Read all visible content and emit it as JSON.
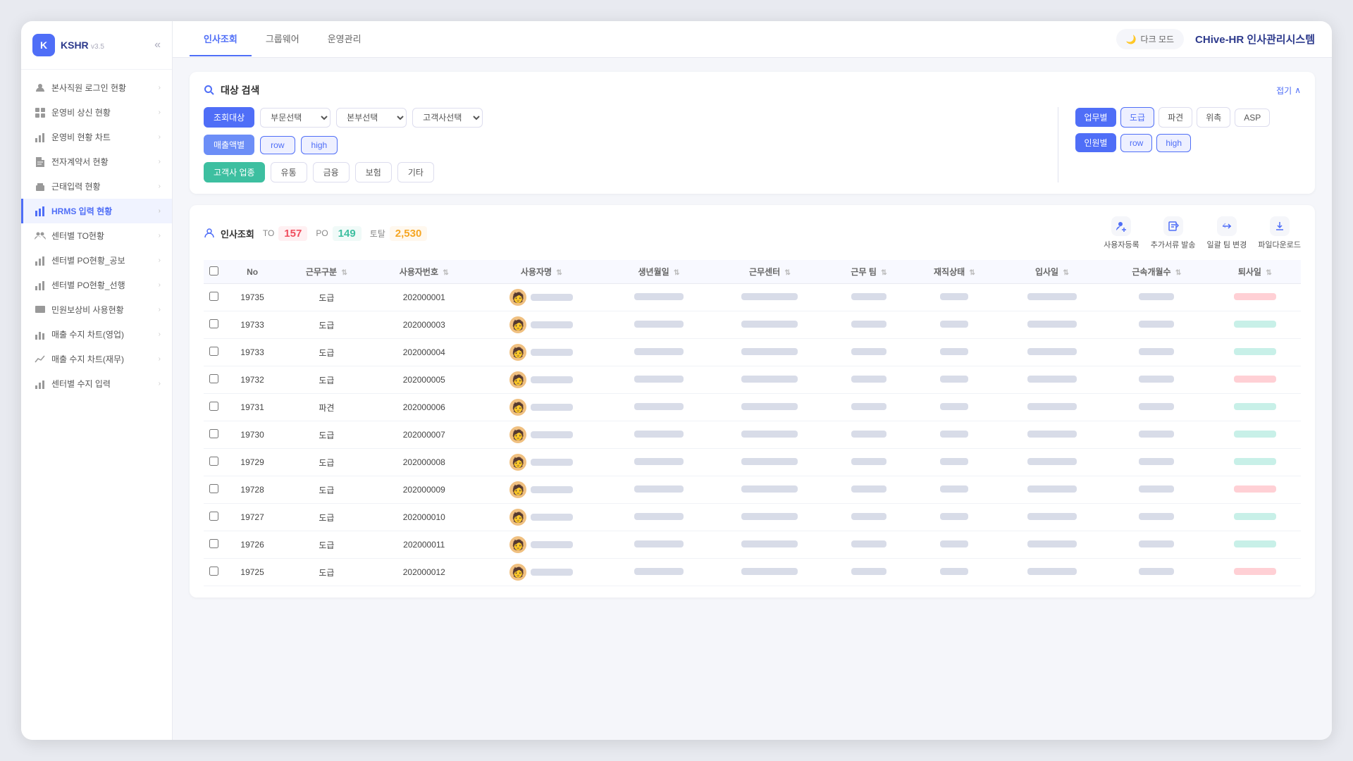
{
  "app": {
    "logo_text": "KSHR",
    "logo_version": "v3.5",
    "title": "CHive-HR 인사관리시스템",
    "dark_mode_label": "다크 모드"
  },
  "header_tabs": [
    {
      "label": "인사조회",
      "active": true
    },
    {
      "label": "그룹웨어",
      "active": false
    },
    {
      "label": "운영관리",
      "active": false
    }
  ],
  "sidebar": {
    "items": [
      {
        "label": "본사직원 로그인 현황",
        "icon": "person",
        "active": false
      },
      {
        "label": "운영비 상신 현황",
        "icon": "grid",
        "active": false
      },
      {
        "label": "운영비 현황 차트",
        "icon": "bar-chart",
        "active": false
      },
      {
        "label": "전자계약서 현황",
        "icon": "document",
        "active": false
      },
      {
        "label": "근태입력 현황",
        "icon": "print",
        "active": false
      },
      {
        "label": "HRMS 입력 현황",
        "icon": "bar-chart-2",
        "active": true
      },
      {
        "label": "센터별 TO현황",
        "icon": "person-group",
        "active": false
      },
      {
        "label": "센터별 PO현황_공보",
        "icon": "chart-bar",
        "active": false
      },
      {
        "label": "센터별 PO현황_선행",
        "icon": "chart-bar2",
        "active": false
      },
      {
        "label": "민원보상비 사용현황",
        "icon": "monitor",
        "active": false
      },
      {
        "label": "매출 수지 차트(영업)",
        "icon": "bar3",
        "active": false
      },
      {
        "label": "매출 수지 차트(재무)",
        "icon": "line-chart",
        "active": false
      },
      {
        "label": "센터별 수지 입력",
        "icon": "bar4",
        "active": false
      }
    ]
  },
  "search": {
    "title": "대상 검색",
    "fold_label": "접기",
    "rows": {
      "row1": {
        "label": "조회대상",
        "selects": [
          "부문선택",
          "본부선택",
          "고객사선택"
        ]
      },
      "row2": {
        "label": "매출액별",
        "tags": [
          "row",
          "high"
        ]
      },
      "row3": {
        "label": "고객사 업종",
        "tags": [
          "유통",
          "금융",
          "보험",
          "기타"
        ]
      }
    },
    "right": {
      "row1": {
        "label": "업무별",
        "tags": [
          "도급",
          "파견",
          "위촉",
          "ASP"
        ]
      },
      "row2": {
        "label": "인원별",
        "tags": [
          "row",
          "high"
        ]
      }
    }
  },
  "table": {
    "title": "인사조회",
    "stats": {
      "to_label": "TO",
      "to_value": "157",
      "po_label": "PO",
      "po_value": "149",
      "total_label": "토탈",
      "total_value": "2,530"
    },
    "actions": [
      {
        "label": "사용자등록",
        "icon": "person-add"
      },
      {
        "label": "추가서류 발송",
        "icon": "document-send"
      },
      {
        "label": "일괄 팀 변경",
        "icon": "team-change"
      },
      {
        "label": "파일다운로드",
        "icon": "download"
      }
    ],
    "columns": [
      "No",
      "근무구분",
      "사용자번호",
      "사용자명",
      "생년월일",
      "근무센터",
      "근무 팀",
      "재직상태",
      "입사일",
      "근속개월수",
      "퇴사일"
    ],
    "rows": [
      {
        "no": "19735",
        "type": "도급",
        "id": "202000001"
      },
      {
        "no": "19733",
        "type": "도급",
        "id": "202000003"
      },
      {
        "no": "19733",
        "type": "도급",
        "id": "202000004"
      },
      {
        "no": "19732",
        "type": "도급",
        "id": "202000005"
      },
      {
        "no": "19731",
        "type": "파견",
        "id": "202000006"
      },
      {
        "no": "19730",
        "type": "도급",
        "id": "202000007"
      },
      {
        "no": "19729",
        "type": "도급",
        "id": "202000008"
      },
      {
        "no": "19728",
        "type": "도급",
        "id": "202000009"
      },
      {
        "no": "19727",
        "type": "도급",
        "id": "202000010"
      },
      {
        "no": "19726",
        "type": "도급",
        "id": "202000011"
      },
      {
        "no": "19725",
        "type": "도급",
        "id": "202000012"
      }
    ]
  }
}
